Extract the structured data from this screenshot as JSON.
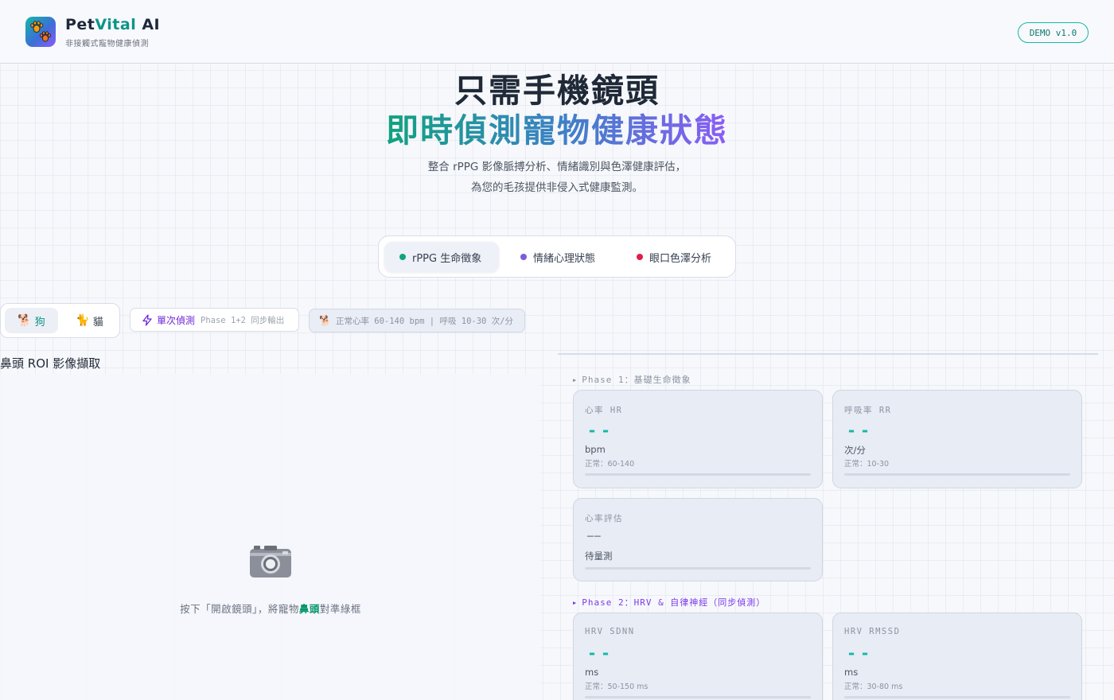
{
  "header": {
    "brand_part1": "Pet",
    "brand_part2": "Vital",
    "brand_part3": " AI",
    "subtitle": "非接觸式寵物健康偵測",
    "version": "DEMO v1.0"
  },
  "hero": {
    "line1": "只需手機鏡頭",
    "line2": "即時偵測寵物健康狀態",
    "desc_line1": "整合 rPPG 影像脈搏分析、情緒識別與色澤健康評估，",
    "desc_line2": "為您的毛孩提供非侵入式健康監測。"
  },
  "mode_tabs": [
    {
      "label": "rPPG 生命徵象",
      "dot_color": "#10a37f",
      "active": true
    },
    {
      "label": "情緒心理狀態",
      "dot_color": "#7c5cdb",
      "active": false
    },
    {
      "label": "眼口色澤分析",
      "dot_color": "#e11d48",
      "active": false
    }
  ],
  "species": {
    "dog_icon": "🐕",
    "dog_label": "狗",
    "cat_icon": "🐈",
    "cat_label": "貓"
  },
  "single_detect": {
    "icon": "lightning-icon",
    "label": "單次偵測",
    "phase": "Phase 1+2 同步輸出"
  },
  "normal_range": {
    "icon": "🐕",
    "text": "正常心率 60-140 bpm | 呼吸 10-30 次/分"
  },
  "camera": {
    "title": "鼻頭 ROI 影像擷取",
    "hint_pre": "按下「開啟鏡頭」，將寵物",
    "hint_bold": "鼻頭",
    "hint_post": "對準綠框"
  },
  "phase1": {
    "label": "Phase 1：基礎生命徵象",
    "hr": {
      "title": "心率 HR",
      "value": "--",
      "unit": "bpm",
      "range": "正常：60-140"
    },
    "rr": {
      "title": "呼吸率 RR",
      "value": "--",
      "unit": "次/分",
      "range": "正常：10-30"
    },
    "eval": {
      "title": "心率評估",
      "value": "——",
      "status": "待量測"
    }
  },
  "phase2": {
    "label": "Phase 2：HRV & 自律神經（同步偵測）",
    "sdnn": {
      "title": "HRV SDNN",
      "value": "--",
      "unit": "ms",
      "range": "正常：50-150 ms"
    },
    "rmssd": {
      "title": "HRV RMSSD",
      "value": "--",
      "unit": "ms",
      "range": "正常：30-80 ms"
    }
  },
  "colors": {
    "accent_teal": "#14b8a6",
    "accent_purple": "#7c3aed",
    "accent_green": "#059669"
  }
}
